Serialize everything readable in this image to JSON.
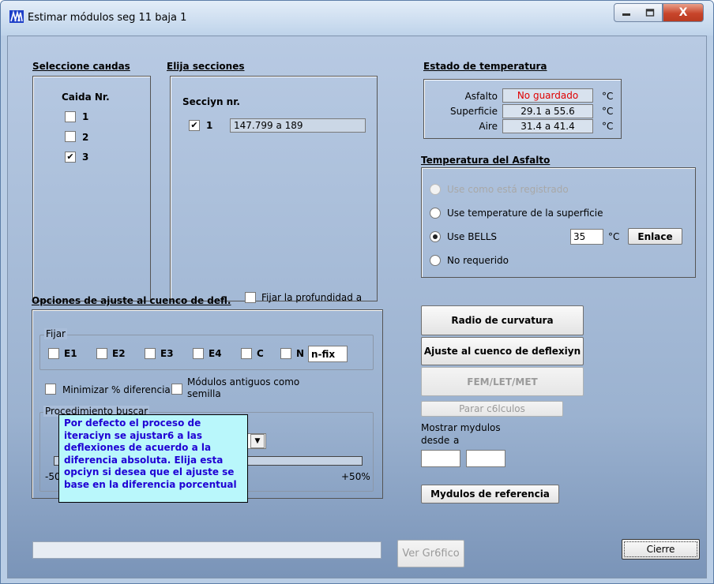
{
  "window": {
    "title": "Estimar módulos seg 11 baja 1",
    "close_glyph": "X"
  },
  "caidas": {
    "header": "Seleccione caнdas",
    "subtitle": "Caida Nr.",
    "items": [
      {
        "label": "1",
        "checked": false
      },
      {
        "label": "2",
        "checked": false
      },
      {
        "label": "3",
        "checked": true
      }
    ]
  },
  "secciones": {
    "header": "Elija secciones",
    "subtitle": "Secciyn nr.",
    "item": {
      "label": "1",
      "checked": true,
      "range": "147.799 a  189"
    }
  },
  "temperatura": {
    "header": "Estado de temperatura",
    "rows": [
      {
        "label": "Asfalto",
        "value": "No guardado",
        "unit": "°C"
      },
      {
        "label": "Superficie",
        "value": "29.1  a  55.6",
        "unit": "°C"
      },
      {
        "label": "Aire",
        "value": "31.4  a  41.4",
        "unit": "°C"
      }
    ]
  },
  "asfalto": {
    "header": "Temperatura del Asfalto",
    "options": [
      "Use como está registrado",
      "Use temperature de la superficie",
      "Use BELLS",
      "No requerido"
    ],
    "selected_index": 2,
    "bells_value": "35",
    "unit": "°C",
    "enlace_label": "Enlace"
  },
  "ajuste": {
    "header": "Opciones de ajuste al cuenco de defl.",
    "fijar_prof_label": "Fijar la profundidad a",
    "fijar_legend": "Fijar",
    "fijar_items": [
      "E1",
      "E2",
      "E3",
      "E4",
      "C",
      "N"
    ],
    "nfix_value": "n-fix",
    "minimizar_label": "Minimizar % diferencia",
    "modulos_antiguos_label_1": "Módulos antiguos como",
    "modulos_antiguos_label_2": "semilla",
    "procedimiento_legend": "Procedimiento buscar",
    "scale_min": "-50%",
    "scale_max": "+50%",
    "tooltip": "Por defecto el proceso de iteraciyn se ajustar6 a las deflexiones de acuerdo a la diferencia absoluta. Elija esta opciyn si desea que el ajuste se base en la diferencia porcentual"
  },
  "acciones": {
    "radio_curvatura": "Radio de curvatura",
    "ajuste_cuenco": "Ajuste al cuenco de deflexiyn",
    "fem": "FEM/LET/MET",
    "parar": "Parar c6lculos",
    "mostrar_1": "Mostrar mydulos",
    "desde": "desde",
    "a": "a",
    "referencia": "Mydulos de referencia"
  },
  "footer": {
    "ver_grafico": "Ver Gr6fico",
    "cierre": "Cierre"
  }
}
